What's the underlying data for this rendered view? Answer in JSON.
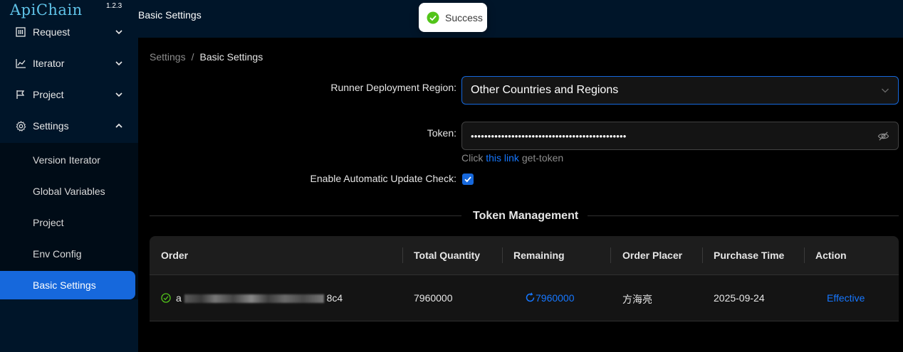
{
  "app": {
    "name": "ApiChain",
    "version": "1.2.3"
  },
  "sidebar": {
    "items": [
      {
        "label": "Request",
        "icon": "request-icon",
        "expanded": false
      },
      {
        "label": "Iterator",
        "icon": "chart-line-icon",
        "expanded": false
      },
      {
        "label": "Project",
        "icon": "flag-icon",
        "expanded": false
      },
      {
        "label": "Settings",
        "icon": "gear-icon",
        "expanded": true
      }
    ],
    "subitems": [
      {
        "label": "Version Iterator",
        "active": false
      },
      {
        "label": "Global Variables",
        "active": false
      },
      {
        "label": "Project",
        "active": false
      },
      {
        "label": "Env Config",
        "active": false
      },
      {
        "label": "Basic Settings",
        "active": true
      }
    ]
  },
  "header": {
    "title": "Basic Settings"
  },
  "toast": {
    "text": "Success",
    "icon": "check-circle-icon",
    "color": "#52c41a"
  },
  "breadcrumb": {
    "parent": "Settings",
    "separator": "/",
    "current": "Basic Settings"
  },
  "form": {
    "region_label": "Runner Deployment Region",
    "region_value": "Other Countries and Regions",
    "token_label": "Token",
    "token_value": "••••••••••••••••••••••••••••••••••••••••••••••",
    "hint_prefix": "Click",
    "hint_link": "this link",
    "hint_suffix": "get-token",
    "auto_update_label": "Enable Automatic Update Check",
    "auto_update_checked": true,
    "colon": ":"
  },
  "token_management": {
    "title": "Token Management",
    "columns": [
      "Order",
      "Total Quantity",
      "Remaining",
      "Order Placer",
      "Purchase Time",
      "Action"
    ],
    "rows": [
      {
        "order_prefix": "a",
        "order_suffix": "8c4",
        "total_quantity": "7960000",
        "remaining": "7960000",
        "order_placer": "方海亮",
        "purchase_time": "2025-09-24",
        "action": "Effective"
      }
    ]
  },
  "colors": {
    "accent": "#1668dc",
    "link": "#1677ff",
    "sidebar_bg": "#001529",
    "success": "#52c41a"
  }
}
